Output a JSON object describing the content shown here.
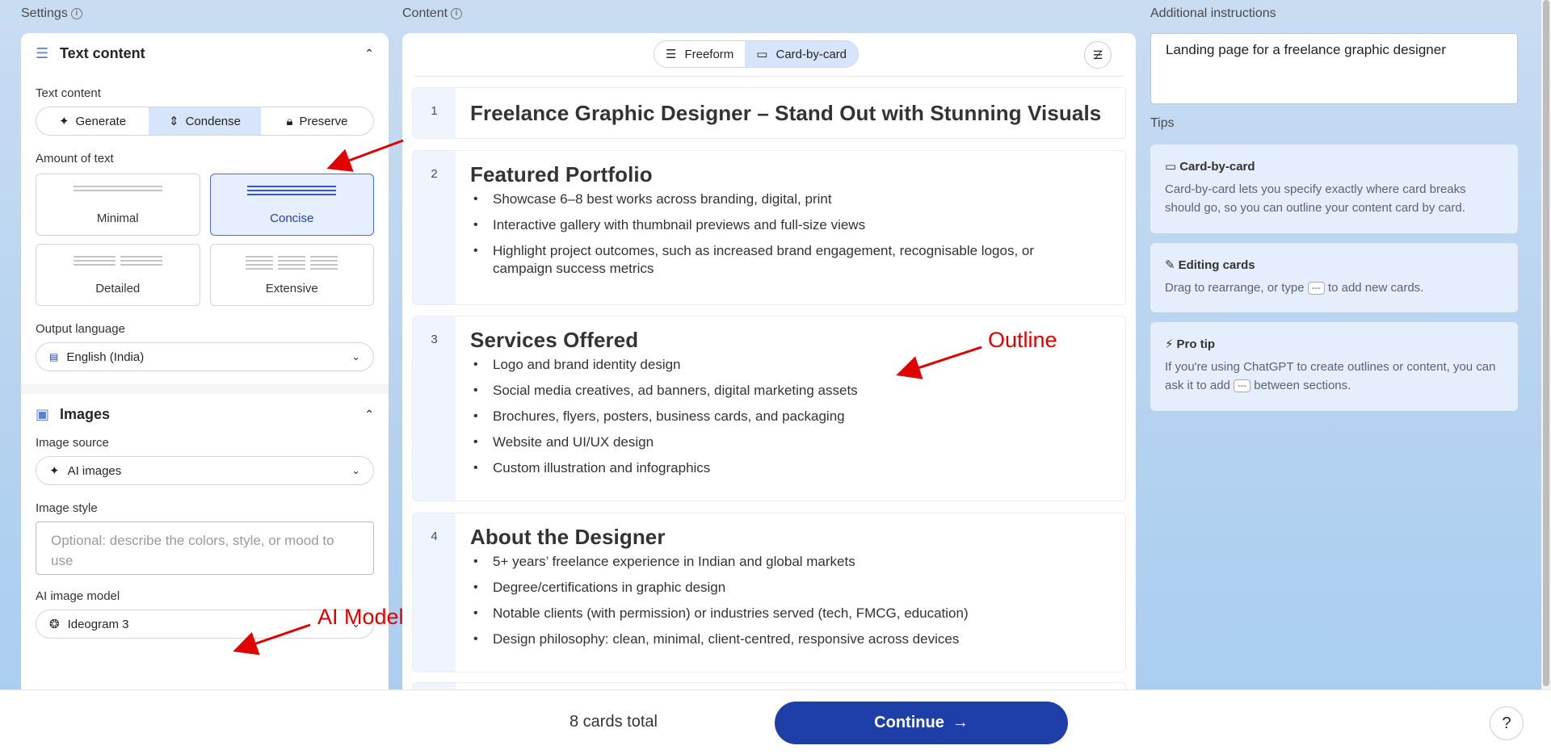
{
  "columns": {
    "settings": "Settings",
    "content": "Content",
    "additional": "Additional instructions",
    "tips": "Tips"
  },
  "text_content": {
    "section_title": "Text content",
    "field_label": "Text content",
    "modes": [
      "Generate",
      "Condense",
      "Preserve"
    ],
    "active_mode": "Condense",
    "amount_label": "Amount of text",
    "amounts": [
      "Minimal",
      "Concise",
      "Detailed",
      "Extensive"
    ],
    "selected_amount": "Concise",
    "language_label": "Output language",
    "language_value": "English (India)"
  },
  "images": {
    "section_title": "Images",
    "source_label": "Image source",
    "source_value": "AI images",
    "style_label": "Image style",
    "style_placeholder": "Optional: describe the colors, style, or mood to use",
    "model_label": "AI image model",
    "model_value": "Ideogram 3"
  },
  "content": {
    "modes": [
      "Freeform",
      "Card-by-card"
    ],
    "active_mode": "Card-by-card",
    "cards": [
      {
        "num": "1",
        "title": "Freelance Graphic Designer – Stand Out with Stunning Visuals",
        "bullets": []
      },
      {
        "num": "2",
        "title": "Featured Portfolio",
        "bullets": [
          "Showcase 6–8 best works across branding, digital, print",
          "Interactive gallery with thumbnail previews and full-size views",
          "Highlight project outcomes, such as increased brand engagement, recognisable logos, or campaign success metrics"
        ]
      },
      {
        "num": "3",
        "title": "Services Offered",
        "bullets": [
          "Logo and brand identity design",
          "Social media creatives, ad banners, digital marketing assets",
          "Brochures, flyers, posters, business cards, and packaging",
          "Website and UI/UX design",
          "Custom illustration and infographics"
        ]
      },
      {
        "num": "4",
        "title": "About the Designer",
        "bullets": [
          "5+ years’ freelance experience in Indian and global markets",
          "Degree/certifications in graphic design",
          "Notable clients (with permission) or industries served (tech, FMCG, education)",
          "Design philosophy: clean, minimal, client-centred, responsive across devices"
        ]
      }
    ]
  },
  "instructions": {
    "value": "Landing page for a freelance graphic designer"
  },
  "tips": [
    {
      "title": "Card-by-card",
      "text": "Card-by-card lets you specify exactly where card breaks should go, so you can outline your content card by card."
    },
    {
      "title": "Editing cards",
      "text_before": "Drag to rearrange, or type",
      "kbd": "---",
      "text_after": "to add new cards."
    },
    {
      "title": "Pro tip",
      "text_before": "If you're using ChatGPT to create outlines or content, you can ask it to add",
      "kbd": "---",
      "text_after": "between sections."
    }
  ],
  "footer": {
    "cards_total": "8 cards total",
    "continue_label": "Continue",
    "help_label": "?"
  },
  "annotations": {
    "outline": "Outline",
    "ai_model": "AI Model"
  },
  "colors": {
    "accent": "#1e3ea8",
    "active_segment": "#d6e5fb",
    "annotation": "#e00000"
  }
}
